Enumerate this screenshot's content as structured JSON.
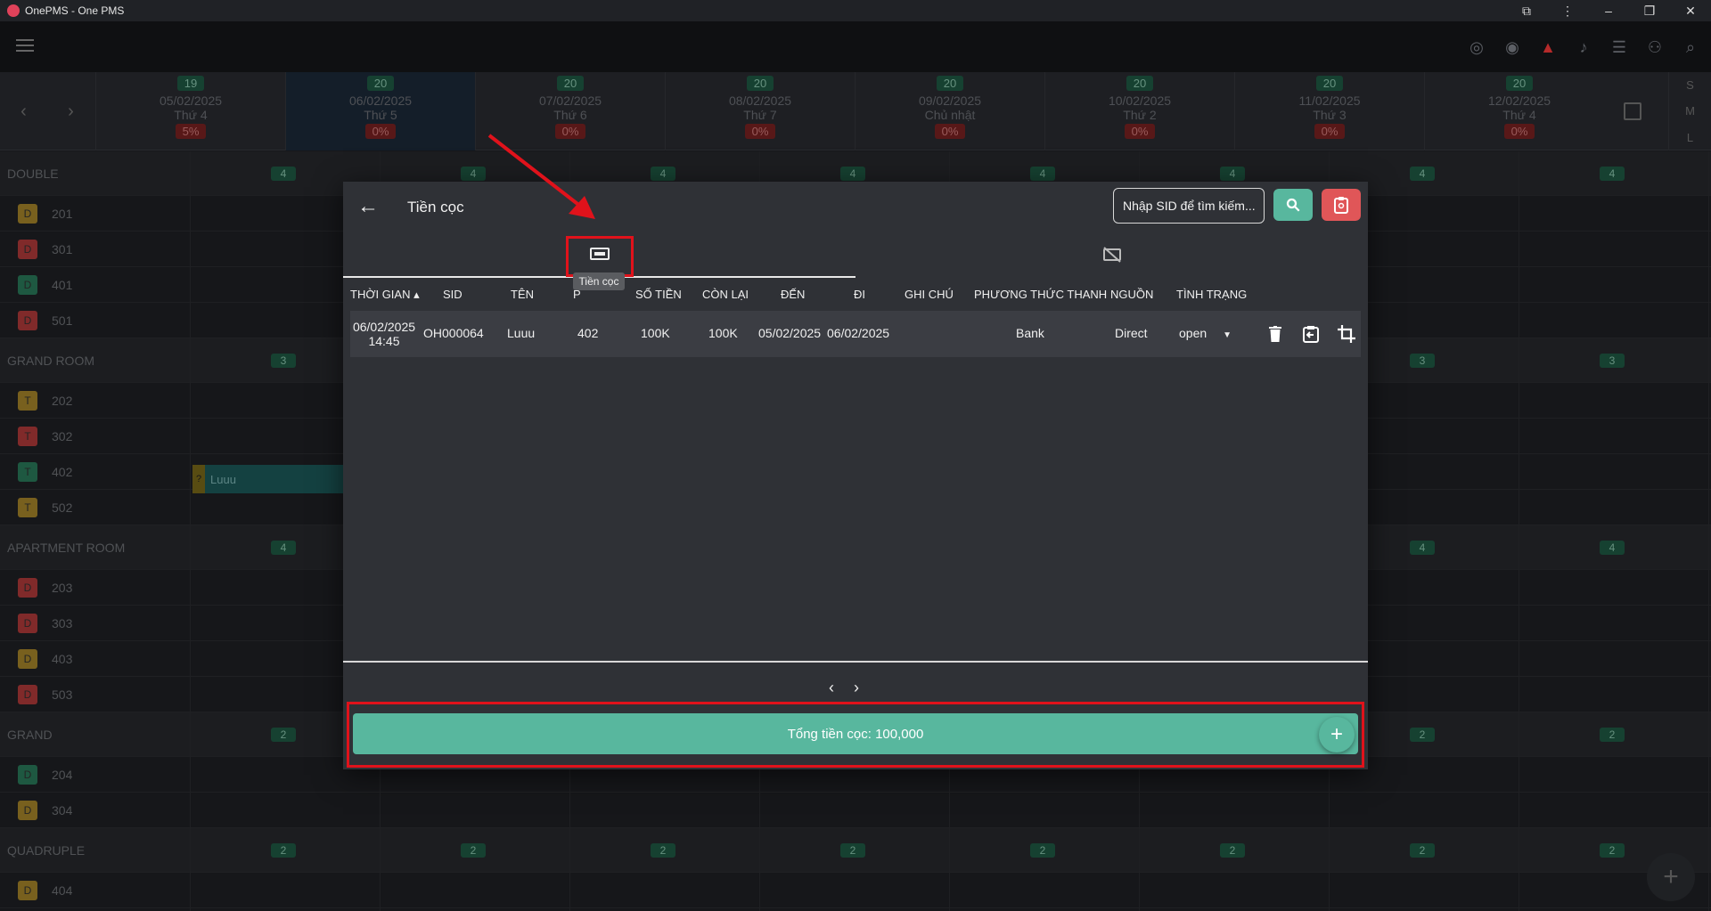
{
  "window": {
    "title": "OnePMS - One PMS"
  },
  "calendar": {
    "days": [
      {
        "count": "19",
        "date": "05/02/2025",
        "dow": "Thứ 4",
        "pct": "5%"
      },
      {
        "count": "20",
        "date": "06/02/2025",
        "dow": "Thứ 5",
        "pct": "0%"
      },
      {
        "count": "20",
        "date": "07/02/2025",
        "dow": "Thứ 6",
        "pct": "0%"
      },
      {
        "count": "20",
        "date": "08/02/2025",
        "dow": "Thứ 7",
        "pct": "0%"
      },
      {
        "count": "20",
        "date": "09/02/2025",
        "dow": "Chủ nhật",
        "pct": "0%"
      },
      {
        "count": "20",
        "date": "10/02/2025",
        "dow": "Thứ 2",
        "pct": "0%"
      },
      {
        "count": "20",
        "date": "11/02/2025",
        "dow": "Thứ 3",
        "pct": "0%"
      },
      {
        "count": "20",
        "date": "12/02/2025",
        "dow": "Thứ 4",
        "pct": "0%"
      }
    ],
    "view_modes": [
      "S",
      "M",
      "L"
    ],
    "categories": [
      {
        "name": "DOUBLE",
        "avail": "4",
        "rooms": [
          {
            "code": "D",
            "num": "201",
            "color": "#a7862a"
          },
          {
            "code": "D",
            "num": "301",
            "color": "#b23b3b"
          },
          {
            "code": "D",
            "num": "401",
            "color": "#2a7a5a"
          },
          {
            "code": "D",
            "num": "501",
            "color": "#b23b3b"
          }
        ]
      },
      {
        "name": "GRAND ROOM",
        "avail": "3",
        "rooms": [
          {
            "code": "T",
            "num": "202",
            "color": "#a7862a"
          },
          {
            "code": "T",
            "num": "302",
            "color": "#b23b3b"
          },
          {
            "code": "T",
            "num": "402",
            "color": "#2a7a5a"
          },
          {
            "code": "T",
            "num": "502",
            "color": "#a7862a"
          }
        ]
      },
      {
        "name": "APARTMENT ROOM",
        "avail": "4",
        "rooms": [
          {
            "code": "D",
            "num": "203",
            "color": "#b23b3b"
          },
          {
            "code": "D",
            "num": "303",
            "color": "#b23b3b"
          },
          {
            "code": "D",
            "num": "403",
            "color": "#a7862a"
          },
          {
            "code": "D",
            "num": "503",
            "color": "#b23b3b"
          }
        ]
      },
      {
        "name": "GRAND",
        "avail": "2",
        "rooms": [
          {
            "code": "D",
            "num": "204",
            "color": "#2a7a5a"
          },
          {
            "code": "D",
            "num": "304",
            "color": "#a7862a"
          }
        ]
      },
      {
        "name": "QUADRUPLE",
        "avail": "2",
        "rooms": [
          {
            "code": "D",
            "num": "404",
            "color": "#a7862a"
          }
        ]
      }
    ],
    "booking_label": "Luuu",
    "booking_marker": "?"
  },
  "modal": {
    "title": "Tiền cọc",
    "search_placeholder": "Nhập SID để tìm kiếm...",
    "tooltip": "Tiền cọc",
    "columns": [
      "THỜI GIAN",
      "SID",
      "TÊN",
      "P",
      "SỐ TIỀN",
      "CÒN LẠI",
      "ĐẾN",
      "ĐI",
      "GHI CHÚ",
      "PHƯƠNG THỨC THANH",
      "NGUỒN",
      "TÌNH TRẠNG"
    ],
    "rows": [
      {
        "time_date": "06/02/2025",
        "time_hour": "14:45",
        "sid": "OH000064",
        "name": "Luuu",
        "room": "402",
        "amount": "100K",
        "remaining": "100K",
        "arrive": "05/02/2025",
        "depart": "06/02/2025",
        "note": "",
        "method": "Bank",
        "source": "Direct",
        "status": "open"
      }
    ],
    "total_label": "Tổng tiền cọc: 100,000"
  },
  "colors": {
    "accent": "#58b79e",
    "danger": "#e05658",
    "highlight": "#e0121b"
  }
}
